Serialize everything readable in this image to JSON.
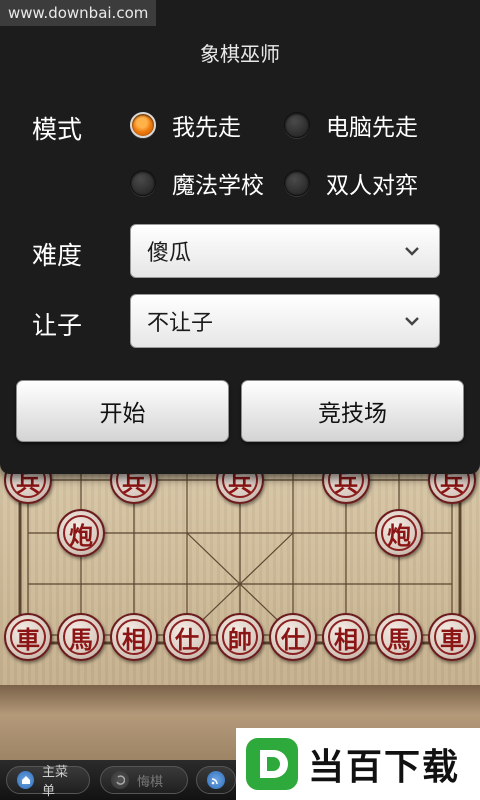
{
  "watermark_top": "www.downbai.com",
  "dialog": {
    "title": "象棋巫师",
    "mode": {
      "label": "模式",
      "options": [
        {
          "label": "我先走",
          "selected": true
        },
        {
          "label": "电脑先走",
          "selected": false
        },
        {
          "label": "魔法学校",
          "selected": false
        },
        {
          "label": "双人对弈",
          "selected": false
        }
      ]
    },
    "difficulty": {
      "label": "难度",
      "value": "傻瓜"
    },
    "handicap": {
      "label": "让子",
      "value": "不让子"
    },
    "start_label": "开始",
    "arena_label": "竞技场"
  },
  "board": {
    "top_row": [
      "兵",
      "兵",
      "兵",
      "兵",
      "兵"
    ],
    "cannons": [
      "炮",
      "炮"
    ],
    "back_row": [
      "車",
      "馬",
      "相",
      "仕",
      "帥",
      "仕",
      "相",
      "馬",
      "車"
    ]
  },
  "bottom_bar": {
    "menu_label": "主菜单",
    "undo_label": "悔棋"
  },
  "logo": {
    "text": "当百下载",
    "mark": "D"
  },
  "colors": {
    "dialog_bg": "#1c1c1c",
    "radio_selected": "#f07c10",
    "piece_red": "#8b1414",
    "board_wood": "#d8c7a6",
    "logo_green": "#2eaa3d"
  }
}
